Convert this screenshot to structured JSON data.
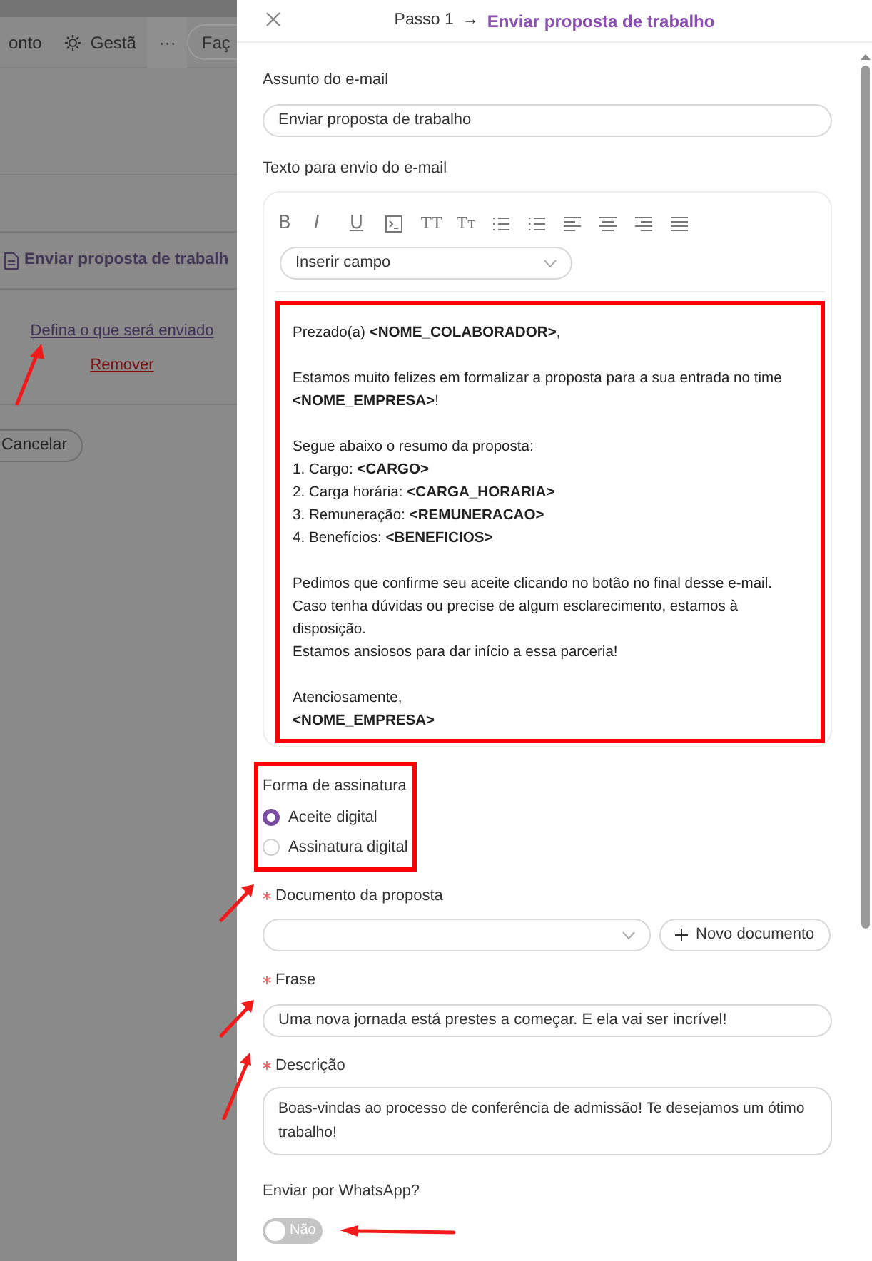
{
  "background": {
    "topbar": {
      "items": [
        {
          "kind": "text",
          "label": "onto"
        },
        {
          "kind": "gear",
          "label": "Gestã"
        },
        {
          "kind": "more",
          "label": "···"
        }
      ],
      "search": {
        "placeholder": "Faç"
      }
    },
    "step": {
      "title": "Enviar proposta de trabalh"
    },
    "define_link": {
      "label": "Defina o que será enviado",
      "arrow": true
    },
    "remove_link": {
      "label": "Remover"
    },
    "cancel_button": {
      "label": "Cancelar"
    }
  },
  "panel": {
    "header": {
      "step": "Passo 1",
      "separator": "→",
      "title": "Enviar proposta de trabalho"
    },
    "subject": {
      "label": "Assunto do e-mail",
      "value": "Enviar proposta de trabalho"
    },
    "email_text": {
      "label": "Texto para envio do e-mail",
      "toolbar": [
        {
          "kind": "bold",
          "label": "B"
        },
        {
          "kind": "italic",
          "label": "I"
        },
        {
          "kind": "underline",
          "label": "U"
        },
        {
          "kind": "code"
        },
        {
          "kind": "size",
          "label": "TT"
        },
        {
          "kind": "case",
          "label": "Tт"
        },
        {
          "kind": "ordered-list"
        },
        {
          "kind": "bullet-list"
        },
        {
          "kind": "align-left"
        },
        {
          "kind": "align-center"
        },
        {
          "kind": "align-right"
        },
        {
          "kind": "justify"
        }
      ],
      "insert_field": {
        "placeholder": "Inserir campo"
      },
      "highlighted": true,
      "body": [
        [
          "Prezado(a) **<NOME_COLABORADOR>**,"
        ],
        [
          "Estamos muito felizes em formalizar a proposta para a sua entrada no time",
          "**<NOME_EMPRESA>**!"
        ],
        [
          "Segue abaixo o resumo da proposta:",
          "1. Cargo: **<CARGO>**",
          "2. Carga horária: **<CARGA_HORARIA>**",
          "3. Remuneração: **<REMUNERACAO>**",
          "4. Benefícios: **<BENEFICIOS>**"
        ],
        [
          "Pedimos que confirme seu aceite clicando no botão no final desse e-mail.",
          "Caso tenha dúvidas ou precise de algum esclarecimento, estamos à",
          "disposição.",
          "Estamos ansiosos para dar início a essa parceria!"
        ],
        [
          "Atenciosamente,",
          "**<NOME_EMPRESA>**"
        ]
      ]
    },
    "signature": {
      "label": "Forma de assinatura",
      "highlighted": true,
      "options": [
        {
          "label": "Aceite digital",
          "selected": true
        },
        {
          "label": "Assinatura digital",
          "selected": false
        }
      ]
    },
    "document": {
      "label": "Documento da proposta",
      "required": true,
      "arrow": true,
      "button": "Novo documento"
    },
    "phrase": {
      "label": "Frase",
      "required": true,
      "arrow": true,
      "value": "Uma nova jornada está prestes a começar. E ela vai ser incrível!"
    },
    "description": {
      "label": "Descrição",
      "required": true,
      "arrow": true,
      "value": "Boas-vindas ao processo de conferência de admissão! Te desejamos um ótimo trabalho!"
    },
    "whatsapp": {
      "label": "Enviar por WhatsApp?",
      "on": false,
      "state_label": "Não",
      "arrow": true
    }
  }
}
